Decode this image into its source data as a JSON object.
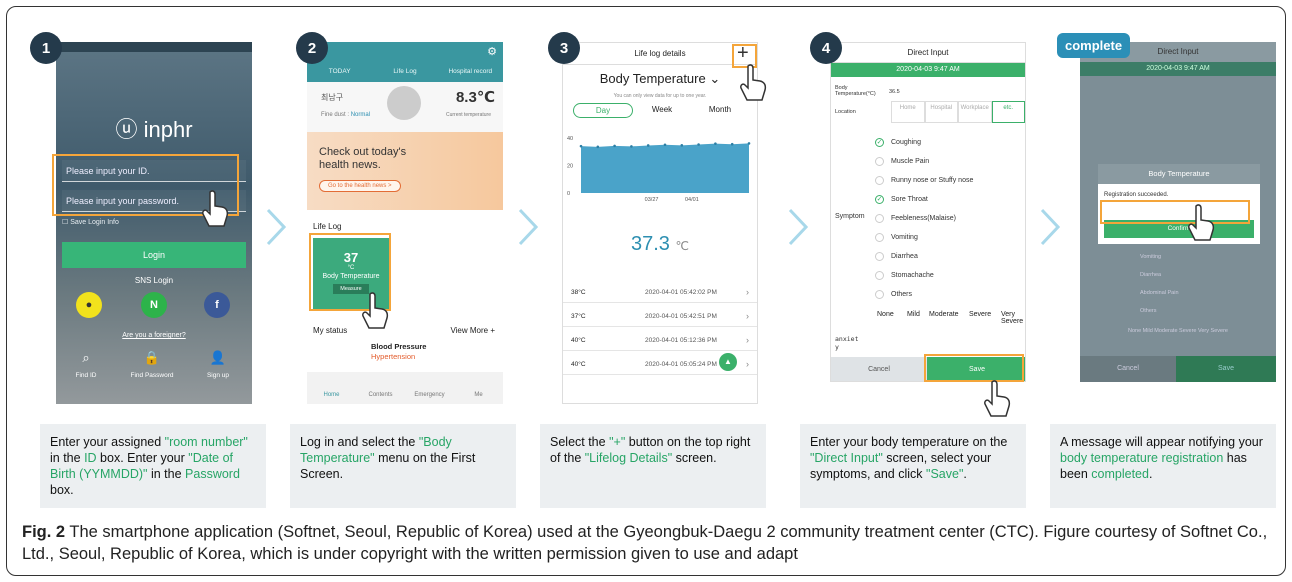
{
  "step1": {
    "badge": "1",
    "logo": "inphr",
    "id_placeholder": "Please input your ID.",
    "pw_placeholder": "Please input your password.",
    "save_login": "Save Login Info",
    "login_label": "Login",
    "sns_login": "SNS Login",
    "foreigner_link": "Are you a foreigner?",
    "find_id": "Find ID",
    "find_password": "Find Password",
    "sign_up": "Sign up",
    "desc_parts": [
      "Enter your assigned ",
      "\"room number\"",
      " in the ",
      "ID",
      " box.  Enter your ",
      "\"Date of Birth (YYMMDD)\"",
      " in the ",
      "Password",
      " box."
    ]
  },
  "step2": {
    "badge": "2",
    "tabs": [
      "TODAY",
      "Life Log",
      "Hospital record"
    ],
    "user_name": "최남구",
    "fine_dust_label": "Fine dust :",
    "fine_dust_value": "Normal",
    "temperature": "8.3℃",
    "temp_caption": "Current temperature",
    "banner_text": "Check out today's health news.",
    "banner_button": "Go to the health news  >",
    "lifelog_label": "Life Log",
    "tile_value": "37",
    "tile_unit": "°C",
    "tile_label": "Body Temperature",
    "tile_button": "Measure",
    "my_status": "My status",
    "view_more": "View More +",
    "bp_label": "Blood Pressure",
    "bp_status": "Hypertension",
    "nav": [
      "Home",
      "Contents",
      "Emergency",
      "Me"
    ],
    "desc_parts": [
      "Log in and select the ",
      "\"Body Temperature\"",
      " menu on the First Screen."
    ]
  },
  "step3": {
    "badge": "3",
    "header": "Life log details",
    "title": "Body Temperature",
    "note": "You can only view data for up to one year.",
    "segments": [
      "Day",
      "Week",
      "Month"
    ],
    "big_value": "37.3",
    "big_unit": "℃",
    "rows": [
      {
        "temp": "38°C",
        "time": "2020-04-01 05:42:02 PM"
      },
      {
        "temp": "37°C",
        "time": "2020-04-01 05:42:51 PM"
      },
      {
        "temp": "40°C",
        "time": "2020-04-01 05:12:36 PM"
      },
      {
        "temp": "40°C",
        "time": "2020-04-01 05:05:24 PM"
      }
    ],
    "chart_data": {
      "type": "area",
      "x": [
        "",
        "03/27",
        "04/01",
        ""
      ],
      "y_ticks": [
        "40",
        "20",
        "0"
      ],
      "values": [
        34,
        33.5,
        34.2,
        33.8,
        34.5,
        35,
        34.6,
        35.2,
        35.8,
        35.4,
        36
      ],
      "ylim": [
        0,
        45
      ]
    },
    "desc_parts": [
      "Select the ",
      "\"+\"",
      " button on the top right of the ",
      "\"Lifelog Details\"",
      " screen."
    ]
  },
  "step4": {
    "badge": "4",
    "header": "Direct Input",
    "date": "2020-04-03 9:47 AM",
    "bt_label": "Body Temperature(°C)",
    "bt_value": "36.5",
    "location_label": "Location",
    "locations": [
      "Home",
      "Hospital",
      "Workplace",
      "etc."
    ],
    "symptom_label": "Symptom",
    "symptoms": [
      "Coughing",
      "Muscle Pain",
      "Runny nose or Stuffy nose",
      "Sore Throat",
      "Feebleness(Malaise)",
      "Vomiting",
      "Diarrhea",
      "Stomachache",
      "Others"
    ],
    "levels": [
      "None",
      "Mild",
      "Moderate",
      "Severe",
      "Very Severe"
    ],
    "anxiety_label": "anxiet y",
    "cancel": "Cancel",
    "save": "Save",
    "desc_parts": [
      "Enter your body temperature on the ",
      "\"Direct Input\"",
      " screen, select your symptoms, and click ",
      "\"Save\"",
      "."
    ]
  },
  "step5": {
    "badge": "complete",
    "header": "Direct Input",
    "date": "2020-04-03 9:47 AM",
    "modal_title": "Body Temperature",
    "modal_message": "Registration succeeded.",
    "confirm": "Confirm",
    "bg_items": [
      "Vomiting",
      "Diarrhea",
      "Abdominal Pain",
      "Others"
    ],
    "levels": "None   Mild   Moderate   Severe   Very Severe",
    "cancel": "Cancel",
    "save": "Save",
    "desc_parts": [
      "A message will appear notifying your ",
      "body temperature registration",
      " has been ",
      "completed",
      "."
    ]
  },
  "caption": {
    "fig": "Fig. 2",
    "text": " The smartphone application (Softnet, Seoul, Republic of Korea) used at the Gyeongbuk-Daegu 2 community treatment center (CTC). Figure courtesy of Softnet Co., Ltd., Seoul, Republic of Korea, which is under copyright with the written permission given to use and adapt"
  }
}
